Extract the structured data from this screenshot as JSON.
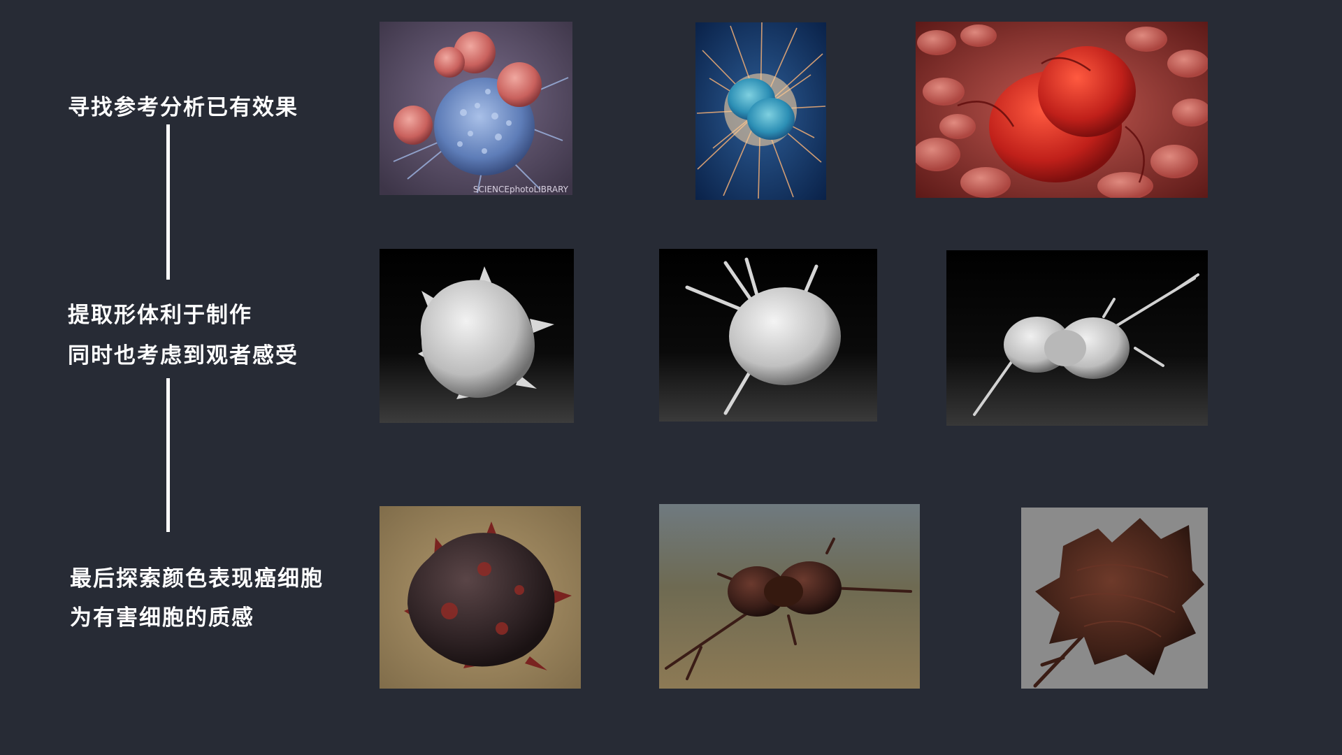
{
  "steps": {
    "step1": "寻找参考分析已有效果",
    "step2_line1": "提取形体利于制作",
    "step2_line2": "同时也考虑到观者感受",
    "step3_line1": "最后探索颜色表现癌细胞",
    "step3_line2": "为有害细胞的质感"
  },
  "reference_row": {
    "watermark": "SCIENCEphotoLIBRARY"
  },
  "images": {
    "row1": [
      "sem-t-cells-attacking-cancer-cell",
      "cancer-cell-dividing-with-filaments",
      "red-cancer-cell-among-blood-cells"
    ],
    "row2": [
      "white-spiky-blob-sculpt",
      "white-blob-with-tendrils-sculpt",
      "white-elongated-cell-sculpt"
    ],
    "row3": [
      "dark-red-spiky-blob-render",
      "dark-red-elongated-cell-render",
      "dark-red-leafy-cell-render"
    ]
  },
  "colors": {
    "background": "#272b35",
    "text": "#ffffff"
  }
}
